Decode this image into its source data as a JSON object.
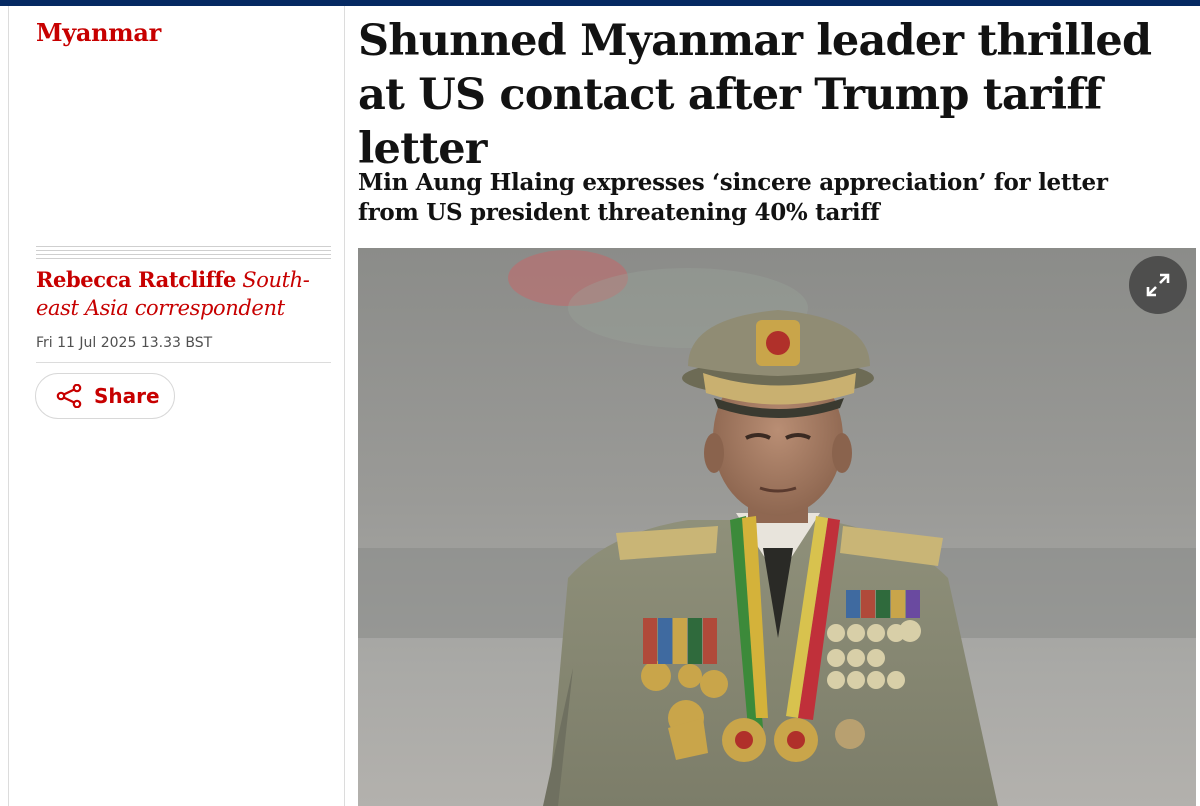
{
  "section": {
    "label": "Myanmar"
  },
  "article": {
    "headline": "Shunned Myanmar leader thrilled at US contact after Trump tariff letter",
    "standfirst": "Min Aung Hlaing expresses ‘sincere appreciation’ for letter from US president threatening 40% tariff"
  },
  "byline": {
    "name": "Rebecca Ratcliffe",
    "role": "South-east Asia correspondent",
    "date": "Fri 11 Jul 2025 13.33 BST"
  },
  "share": {
    "label": "Share",
    "icon": "share-icon"
  },
  "media": {
    "expand_icon": "expand-icon"
  },
  "colors": {
    "brand_navy": "#052962",
    "accent_red": "#c70000",
    "text": "#121212"
  }
}
